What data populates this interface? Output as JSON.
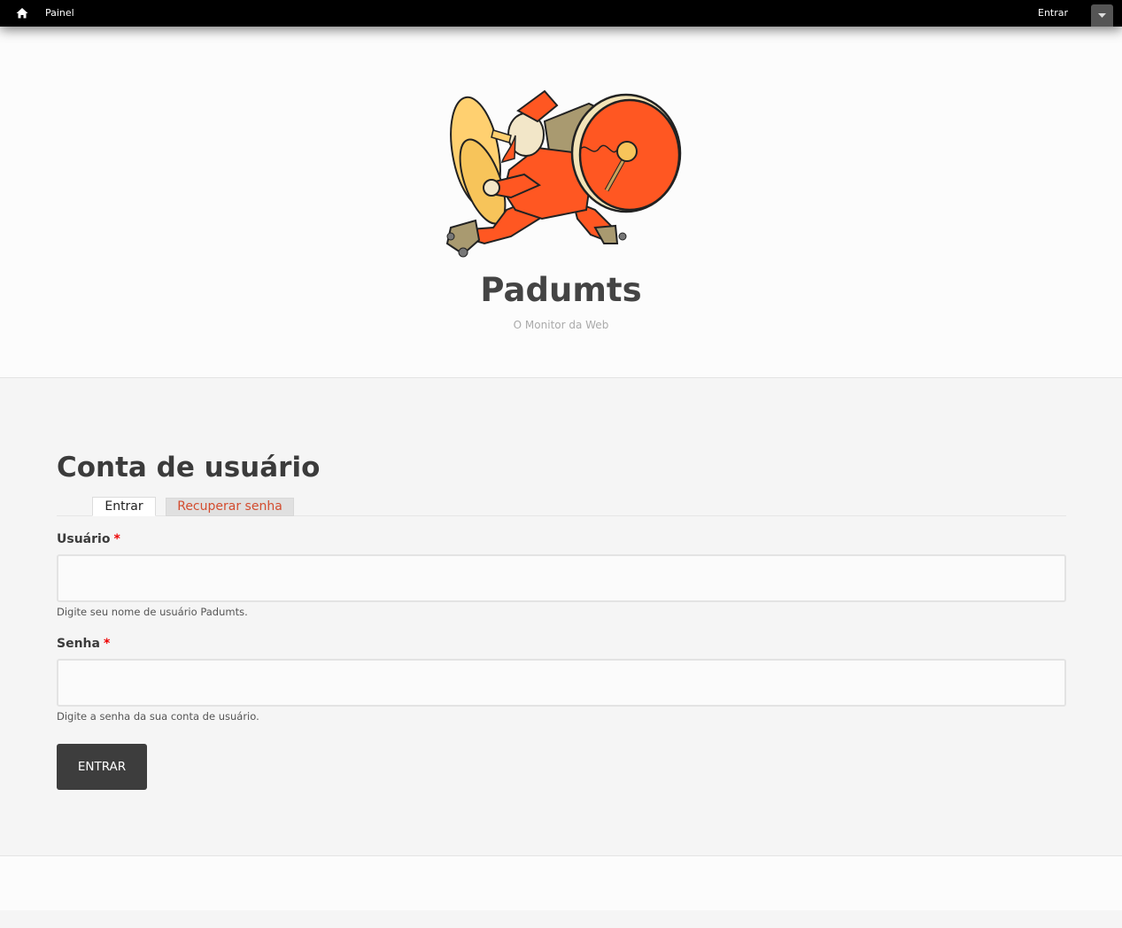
{
  "toolbar": {
    "home_icon": "home-icon",
    "painel_label": "Painel",
    "entrar_label": "Entrar",
    "toggle_icon": "chevron-down-icon"
  },
  "header": {
    "logo": "drummer-mascot-logo",
    "site_name": "Padumts",
    "slogan": "O Monitor da Web"
  },
  "main": {
    "title": "Conta de usuário",
    "tabs": [
      {
        "label": "Entrar",
        "active": true
      },
      {
        "label": "Recuperar senha",
        "active": false
      }
    ],
    "form": {
      "username": {
        "label": "Usuário",
        "required_mark": "*",
        "value": "",
        "description": "Digite seu nome de usuário Padumts."
      },
      "password": {
        "label": "Senha",
        "required_mark": "*",
        "value": "",
        "description": "Digite a senha da sua conta de usuário."
      },
      "submit_label": "ENTRAR"
    }
  },
  "colors": {
    "toolbar_bg": "#000000",
    "accent_link": "#d34c2f",
    "button_bg": "#3d3d3d",
    "required": "#ee0000",
    "drum_red": "#ff5722",
    "cymbal_yellow": "#ffd070"
  }
}
